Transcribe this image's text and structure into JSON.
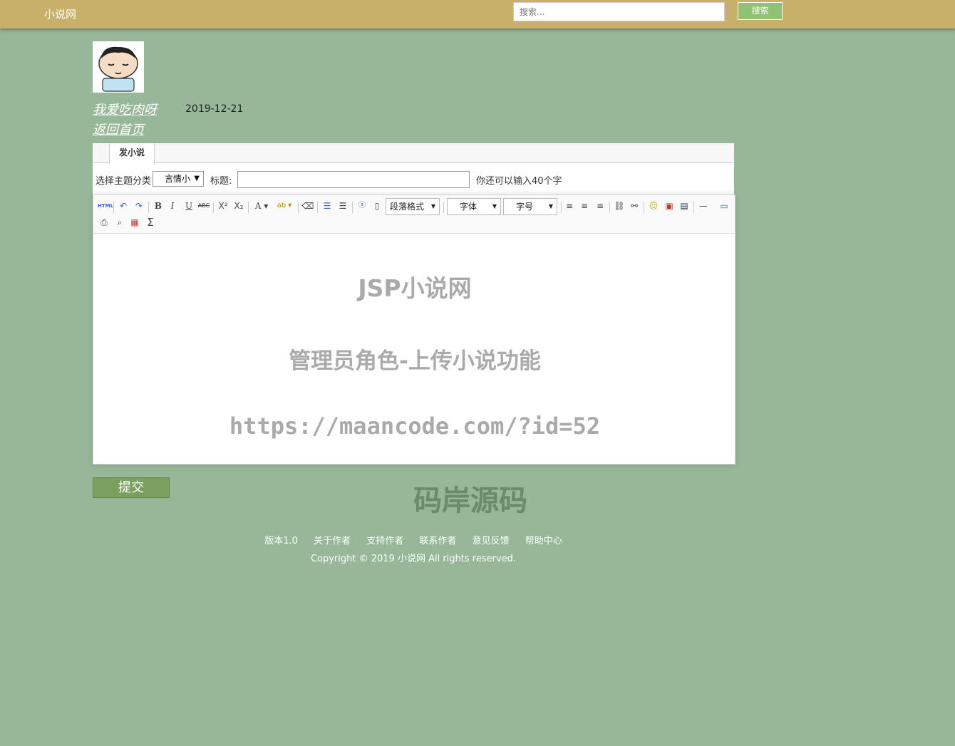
{
  "header": {
    "brand": "小说网",
    "search_placeholder": "搜索...",
    "search_button": "搜索"
  },
  "profile": {
    "username": "我爱吃肉呀",
    "date": "2019-12-21",
    "back_home": "返回首页"
  },
  "tabs": [
    {
      "label": "发小说"
    }
  ],
  "form": {
    "category_label": "选择主题分类",
    "category_value": "言情小",
    "title_label": "标题:",
    "remaining_text": "你还可以输入40个字"
  },
  "toolbar": {
    "html_icon": "HTML",
    "paragraph_format": "段落格式",
    "font_family": "字体",
    "font_size": "字号"
  },
  "watermark": {
    "line1": "JSP小说网",
    "line2": "管理员角色-上传小说功能",
    "line3": "https://maancode.com/?id=52",
    "brand": "码岸源码"
  },
  "submit_label": "提交",
  "footer": {
    "links": [
      "版本1.0",
      "关于作者",
      "支持作者",
      "联系作者",
      "意见反馈",
      "帮助中心"
    ],
    "copyright": "Copyright © 2019 小说网 All rights reserved."
  }
}
